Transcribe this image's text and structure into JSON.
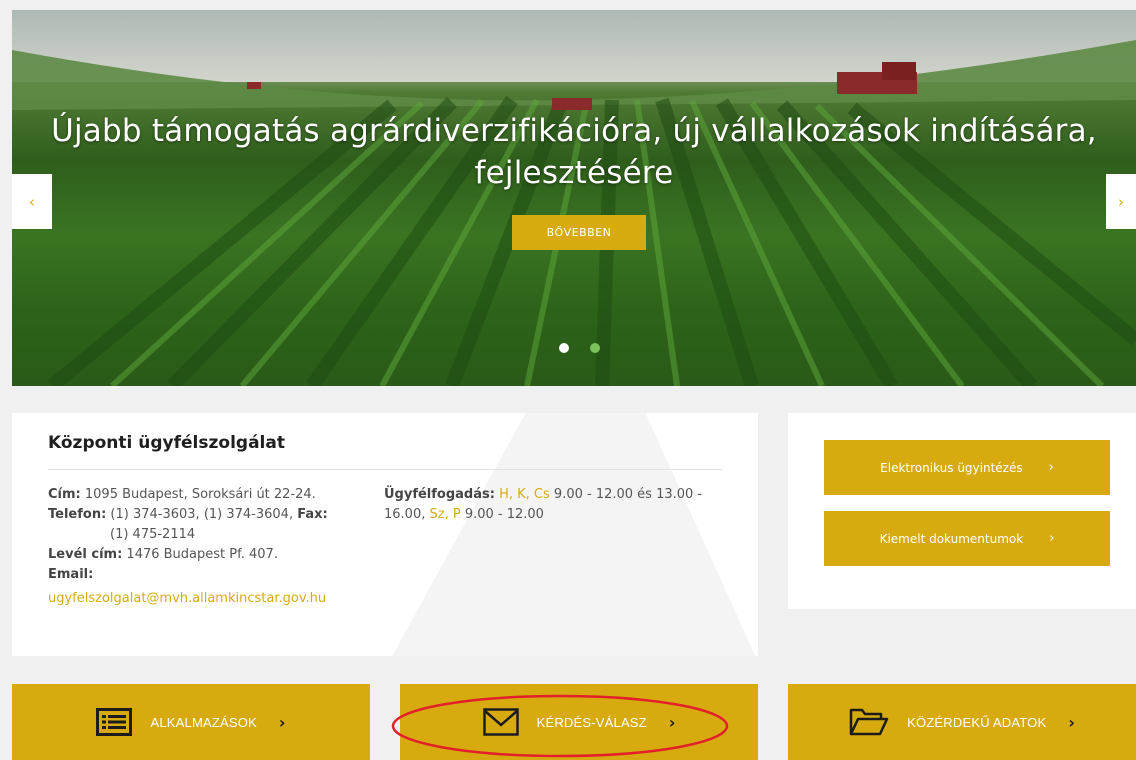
{
  "hero": {
    "title": "Újabb támogatás agrárdiverzifikációra, új vállalkozások indítására, fejlesztésére",
    "button_label": "BŐVEBBEN",
    "prev_arrow": "‹",
    "next_arrow": "›",
    "slide_count": 2,
    "active_slide": 1
  },
  "info": {
    "title": "Központi ügyfélszolgálat",
    "address_label": "Cím:",
    "address": "1095 Budapest, Soroksári út 22-24.",
    "phone_label": "Telefon:",
    "phones": "(1) 374-3603, (1) 374-3604,",
    "fax_label": "Fax:",
    "fax": "(1) 475-2114",
    "mail_label": "Levél cím:",
    "mail": "1476 Budapest Pf. 407.",
    "email_label": "Email:",
    "email": "ugyfelszolgalat@mvh.allamkincstar.gov.hu",
    "hours_label": "Ügyfélfogadás:",
    "hours_days1": "H, K, Cs",
    "hours_time1": "9.00 - 12.00 és 13.00 - 16.00,",
    "hours_days2": "Sz, P",
    "hours_time2": "9.00 - 12.00"
  },
  "side": {
    "btn1": "Elektronikus ügyintézés",
    "btn2": "Kiemelt dokumentumok",
    "chevron": "›"
  },
  "tiles": [
    {
      "label": "ALKALMAZÁSOK",
      "icon": "list-icon"
    },
    {
      "label": "KÉRDÉS-VÁLASZ",
      "icon": "envelope-icon"
    },
    {
      "label": "KÖZÉRDEKŰ ADATOK",
      "icon": "folder-icon"
    }
  ],
  "tile_chevron": "›",
  "colors": {
    "accent": "#d7ab10",
    "highlight_circle": "#e2202a",
    "active_dot": "#ffffff",
    "inactive_dot": "#7cc25a"
  }
}
